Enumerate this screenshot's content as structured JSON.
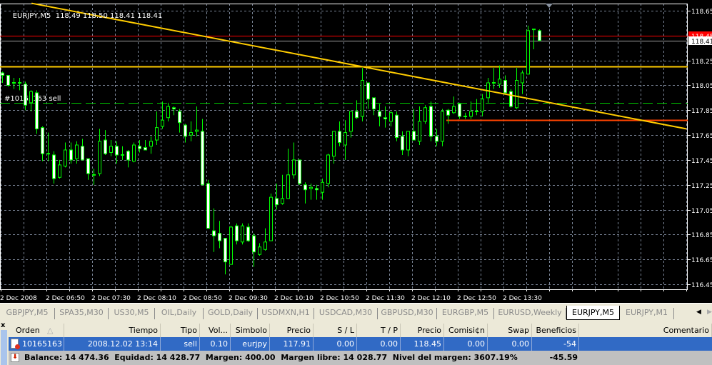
{
  "chart": {
    "symbol_label": "EURJPY,M5",
    "ohlc_label": "118.49 118.50 118.41 118.41",
    "order_label": "#10165163 sell",
    "colors": {
      "background": "#000000",
      "candle_outline": "#00ff00",
      "bull_body": "#000000",
      "bear_body": "#ffffff",
      "grid": "#7a8597",
      "trendline": "#ffcc00",
      "ask_line": "#ff0000",
      "bid_line": "#a0a0a0",
      "order_line": "#00cc00",
      "support_line": "#ff4400"
    }
  },
  "chart_data": {
    "type": "candlestick",
    "symbol": "EURJPY",
    "timeframe": "M5",
    "start_time": "2008.12.02 06:10",
    "interval_minutes": 5,
    "ylim": [
      116.45,
      118.65
    ],
    "grid": true,
    "y_ticks": [
      "118.65",
      "118.45",
      "118.25",
      "118.05",
      "117.85",
      "117.65",
      "117.45",
      "117.25",
      "117.05",
      "116.85",
      "116.65",
      "116.45"
    ],
    "x_ticks": [
      {
        "time": "06:10",
        "label": "2 Dec 2008"
      },
      {
        "time": "06:50",
        "label": "2 Dec 06:50"
      },
      {
        "time": "07:30",
        "label": "2 Dec 07:30"
      },
      {
        "time": "08:10",
        "label": "2 Dec 08:10"
      },
      {
        "time": "08:50",
        "label": "2 Dec 08:50"
      },
      {
        "time": "09:30",
        "label": "2 Dec 09:30"
      },
      {
        "time": "10:10",
        "label": "2 Dec 10:10"
      },
      {
        "time": "10:50",
        "label": "2 Dec 10:50"
      },
      {
        "time": "11:30",
        "label": "2 Dec 11:30"
      },
      {
        "time": "12:10",
        "label": "2 Dec 12:10"
      },
      {
        "time": "12:50",
        "label": "2 Dec 12:50"
      },
      {
        "time": "13:30",
        "label": "2 Dec 13:30"
      }
    ],
    "ohlc": [
      [
        118.15,
        118.16,
        118.07,
        118.13
      ],
      [
        118.13,
        118.13,
        118.04,
        118.05
      ],
      [
        118.07,
        118.11,
        118.02,
        118.07
      ],
      [
        118.07,
        118.11,
        118.01,
        118.07
      ],
      [
        118.06,
        118.08,
        117.85,
        117.89
      ],
      [
        117.91,
        118.01,
        117.84,
        118.0
      ],
      [
        117.99,
        118.01,
        117.66,
        117.7
      ],
      [
        117.71,
        117.72,
        117.44,
        117.5
      ],
      [
        117.5,
        117.67,
        117.44,
        117.5
      ],
      [
        117.49,
        117.52,
        117.26,
        117.3
      ],
      [
        117.31,
        117.45,
        117.3,
        117.41
      ],
      [
        117.4,
        117.59,
        117.39,
        117.53
      ],
      [
        117.53,
        117.59,
        117.42,
        117.45
      ],
      [
        117.46,
        117.6,
        117.42,
        117.57
      ],
      [
        117.56,
        117.62,
        117.45,
        117.45
      ],
      [
        117.46,
        117.46,
        117.29,
        117.34
      ],
      [
        117.33,
        117.38,
        117.25,
        117.33
      ],
      [
        117.34,
        117.7,
        117.32,
        117.6
      ],
      [
        117.61,
        117.69,
        117.49,
        117.5
      ],
      [
        117.51,
        117.61,
        117.48,
        117.56
      ],
      [
        117.56,
        117.6,
        117.42,
        117.49
      ],
      [
        117.49,
        117.56,
        117.45,
        117.49
      ],
      [
        117.52,
        117.53,
        117.39,
        117.45
      ],
      [
        117.44,
        117.59,
        117.43,
        117.57
      ],
      [
        117.56,
        117.61,
        117.51,
        117.54
      ],
      [
        117.55,
        117.61,
        117.53,
        117.53
      ],
      [
        117.56,
        117.64,
        117.5,
        117.6
      ],
      [
        117.61,
        117.84,
        117.57,
        117.71
      ],
      [
        117.72,
        117.92,
        117.7,
        117.77
      ],
      [
        117.79,
        117.91,
        117.76,
        117.88
      ],
      [
        117.87,
        117.88,
        117.81,
        117.86
      ],
      [
        117.84,
        117.86,
        117.67,
        117.75
      ],
      [
        117.73,
        117.74,
        117.59,
        117.64
      ],
      [
        117.65,
        117.76,
        117.6,
        117.67
      ],
      [
        117.68,
        117.88,
        117.64,
        117.69
      ],
      [
        117.68,
        117.78,
        117.25,
        117.25
      ],
      [
        117.26,
        117.29,
        116.9,
        116.9
      ],
      [
        116.88,
        117.06,
        116.71,
        116.84
      ],
      [
        116.86,
        116.96,
        116.74,
        116.8
      ],
      [
        116.82,
        116.82,
        116.53,
        116.63
      ],
      [
        116.61,
        116.92,
        116.61,
        116.91
      ],
      [
        116.92,
        116.94,
        116.77,
        116.8
      ],
      [
        116.79,
        116.94,
        116.77,
        116.92
      ],
      [
        116.91,
        116.94,
        116.79,
        116.8
      ],
      [
        116.84,
        116.86,
        116.59,
        116.71
      ],
      [
        116.69,
        116.78,
        116.68,
        116.75
      ],
      [
        116.73,
        116.9,
        116.72,
        116.79
      ],
      [
        116.8,
        117.18,
        116.8,
        117.15
      ],
      [
        117.14,
        117.26,
        117.05,
        117.09
      ],
      [
        117.1,
        117.33,
        117.09,
        117.14
      ],
      [
        117.14,
        117.54,
        117.14,
        117.33
      ],
      [
        117.33,
        117.59,
        117.3,
        117.45
      ],
      [
        117.45,
        117.45,
        117.25,
        117.26
      ],
      [
        117.25,
        117.27,
        117.1,
        117.21
      ],
      [
        117.22,
        117.26,
        117.13,
        117.23
      ],
      [
        117.22,
        117.25,
        117.13,
        117.21
      ],
      [
        117.19,
        117.3,
        117.13,
        117.27
      ],
      [
        117.26,
        117.5,
        117.23,
        117.49
      ],
      [
        117.48,
        117.68,
        117.42,
        117.68
      ],
      [
        117.68,
        117.76,
        117.56,
        117.59
      ],
      [
        117.57,
        117.77,
        117.45,
        117.67
      ],
      [
        117.68,
        117.84,
        117.63,
        117.84
      ],
      [
        117.84,
        117.93,
        117.78,
        117.79
      ],
      [
        117.8,
        118.19,
        117.76,
        118.09
      ],
      [
        118.07,
        118.07,
        117.86,
        117.94
      ],
      [
        117.95,
        117.95,
        117.81,
        117.86
      ],
      [
        117.84,
        117.9,
        117.72,
        117.8
      ],
      [
        117.79,
        117.88,
        117.71,
        117.78
      ],
      [
        117.76,
        117.84,
        117.72,
        117.83
      ],
      [
        117.81,
        117.84,
        117.6,
        117.63
      ],
      [
        117.64,
        117.68,
        117.49,
        117.53
      ],
      [
        117.53,
        117.68,
        117.48,
        117.68
      ],
      [
        117.68,
        117.86,
        117.61,
        117.61
      ],
      [
        117.6,
        117.88,
        117.57,
        117.76
      ],
      [
        117.76,
        117.89,
        117.74,
        117.87
      ],
      [
        117.88,
        117.92,
        117.6,
        117.64
      ],
      [
        117.64,
        117.7,
        117.56,
        117.6
      ],
      [
        117.6,
        117.86,
        117.56,
        117.84
      ],
      [
        117.85,
        117.86,
        117.74,
        117.81
      ],
      [
        117.83,
        117.96,
        117.82,
        117.88
      ],
      [
        117.9,
        117.91,
        117.78,
        117.8
      ],
      [
        117.8,
        117.83,
        117.78,
        117.8
      ],
      [
        117.8,
        117.92,
        117.78,
        117.84
      ],
      [
        117.84,
        117.94,
        117.81,
        117.84
      ],
      [
        117.84,
        117.98,
        117.8,
        117.94
      ],
      [
        117.95,
        118.11,
        117.91,
        118.07
      ],
      [
        118.07,
        118.19,
        118.02,
        118.07
      ],
      [
        118.06,
        118.21,
        118.03,
        118.1
      ],
      [
        118.09,
        118.13,
        117.98,
        117.99
      ],
      [
        118.0,
        118.02,
        117.87,
        117.88
      ],
      [
        117.87,
        118.19,
        117.86,
        118.09
      ],
      [
        118.07,
        118.17,
        117.98,
        118.15
      ],
      [
        118.14,
        118.53,
        118.14,
        118.49
      ],
      [
        118.5,
        118.5,
        118.34,
        118.5
      ],
      [
        118.49,
        118.5,
        118.41,
        118.41
      ]
    ],
    "price_lines": [
      {
        "name": "ask",
        "price": 118.45,
        "label": "118.45",
        "style": "solid",
        "color": "#ff0000"
      },
      {
        "name": "bid",
        "price": 118.41,
        "label": "118.41",
        "style": "solid",
        "color": "#a0a0a0"
      },
      {
        "name": "horizontal",
        "price": 118.2,
        "style": "solid",
        "color": "#ffcc00"
      },
      {
        "name": "order",
        "price": 117.91,
        "style": "dashed",
        "color": "#00cc00"
      }
    ],
    "segment_line": {
      "from_time": "12:40",
      "price": 117.77,
      "color": "#ff4400"
    },
    "trendline": {
      "from": {
        "time": "06:37",
        "price": 118.71
      },
      "to": {
        "time": "16:10",
        "price": 117.7
      },
      "color": "#ffcc00"
    }
  },
  "tabs": [
    {
      "label": "GBPJPY,M5"
    },
    {
      "label": "SPA35,M30"
    },
    {
      "label": "US30,M5"
    },
    {
      "label": "OIL,Daily"
    },
    {
      "label": "GOLD,Daily"
    },
    {
      "label": "USDMXN,H1"
    },
    {
      "label": "USDCAD,M30"
    },
    {
      "label": "GBPUSD,M30"
    },
    {
      "label": "EURGBP,M5"
    },
    {
      "label": "EURUSD,Weekly"
    },
    {
      "label": "EURJPY,M5",
      "active": true
    },
    {
      "label": "EURJPY,M1"
    }
  ],
  "terminal": {
    "close_label": "x",
    "sort_indicator": "△",
    "columns": [
      "Orden",
      "Tiempo",
      "Tipo",
      "Vol...",
      "Simbolo",
      "Precio",
      "S / L",
      "T / P",
      "Precio",
      "Comisi¢n",
      "Swap",
      "Beneficios",
      "Comentario"
    ],
    "row": [
      "10165163",
      "2008.12.02 13:14",
      "sell",
      "0.10",
      "eurjpy",
      "117.91",
      "0.00",
      "0.00",
      "118.45",
      "0.00",
      "0.00",
      "-54",
      ""
    ],
    "summary": "Balance: 14 474.36  Equidad: 14 428.77  Margen: 400.00  Margen libre: 14 028.77  Nivel del margen: 3607.19%",
    "total": "-45.59"
  }
}
